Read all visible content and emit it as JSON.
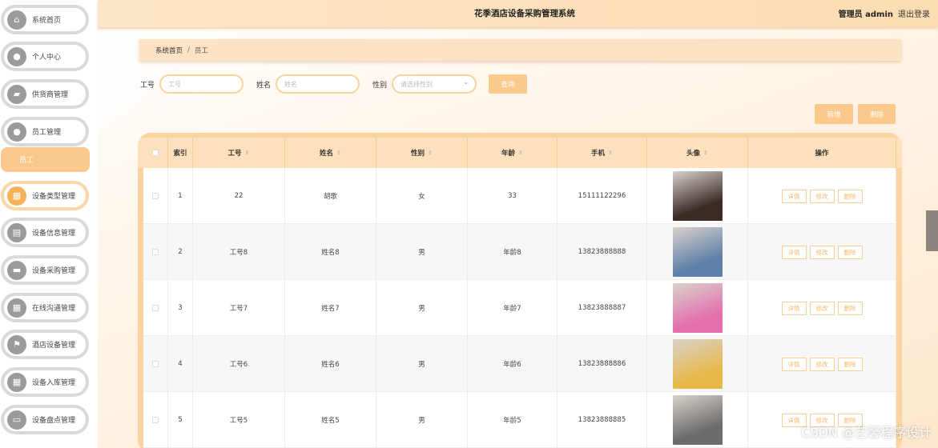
{
  "header": {
    "title": "花季酒店设备采购管理系统",
    "admin": "管理员 admin",
    "logout": "退出登录"
  },
  "sidebar": {
    "items": [
      {
        "label": "系统首页",
        "icon": "home-icon"
      },
      {
        "label": "个人中心",
        "icon": "user-icon"
      },
      {
        "label": "供货商管理",
        "icon": "supplier-icon"
      },
      {
        "label": "员工管理",
        "icon": "user-icon"
      },
      {
        "label": "设备类型管理",
        "icon": "grid-icon"
      },
      {
        "label": "设备信息管理",
        "icon": "document-icon"
      },
      {
        "label": "设备采购管理",
        "icon": "monitor-icon"
      },
      {
        "label": "在线沟通管理",
        "icon": "grid-icon"
      },
      {
        "label": "酒店设备管理",
        "icon": "flag-icon"
      },
      {
        "label": "设备入库管理",
        "icon": "grid-icon"
      },
      {
        "label": "设备盘点管理",
        "icon": "chat-icon"
      }
    ],
    "sub_active": "员工"
  },
  "breadcrumb": {
    "home": "系统首页",
    "separator": "/",
    "current": "员工"
  },
  "search": {
    "id_label": "工号",
    "id_placeholder": "工号",
    "name_label": "姓名",
    "name_placeholder": "姓名",
    "gender_label": "性别",
    "gender_placeholder": "请选择性别",
    "query_button": "查询"
  },
  "actions": {
    "add": "新增",
    "delete": "删除"
  },
  "table": {
    "columns": [
      "索引",
      "工号",
      "姓名",
      "性别",
      "年龄",
      "手机",
      "头像",
      "操作"
    ],
    "row_actions": {
      "detail": "详情",
      "edit": "修改",
      "delete": "删除"
    },
    "rows": [
      {
        "index": "1",
        "id": "22",
        "name": "胡歌",
        "gender": "女",
        "age": "33",
        "phone": "15111122296",
        "avatar": "#3a2b25"
      },
      {
        "index": "2",
        "id": "工号8",
        "name": "姓名8",
        "gender": "男",
        "age": "年龄8",
        "phone": "13823888888",
        "avatar": "#5d7fa8"
      },
      {
        "index": "3",
        "id": "工号7",
        "name": "姓名7",
        "gender": "男",
        "age": "年龄7",
        "phone": "13823888887",
        "avatar": "#e46fae"
      },
      {
        "index": "4",
        "id": "工号6",
        "name": "姓名6",
        "gender": "男",
        "age": "年龄6",
        "phone": "13823888886",
        "avatar": "#e7b84a"
      },
      {
        "index": "5",
        "id": "工号5",
        "name": "姓名5",
        "gender": "男",
        "age": "年龄5",
        "phone": "13823888885",
        "avatar": "#6b6b6b"
      }
    ]
  },
  "watermark": "CSDN @艺馨程序设计"
}
